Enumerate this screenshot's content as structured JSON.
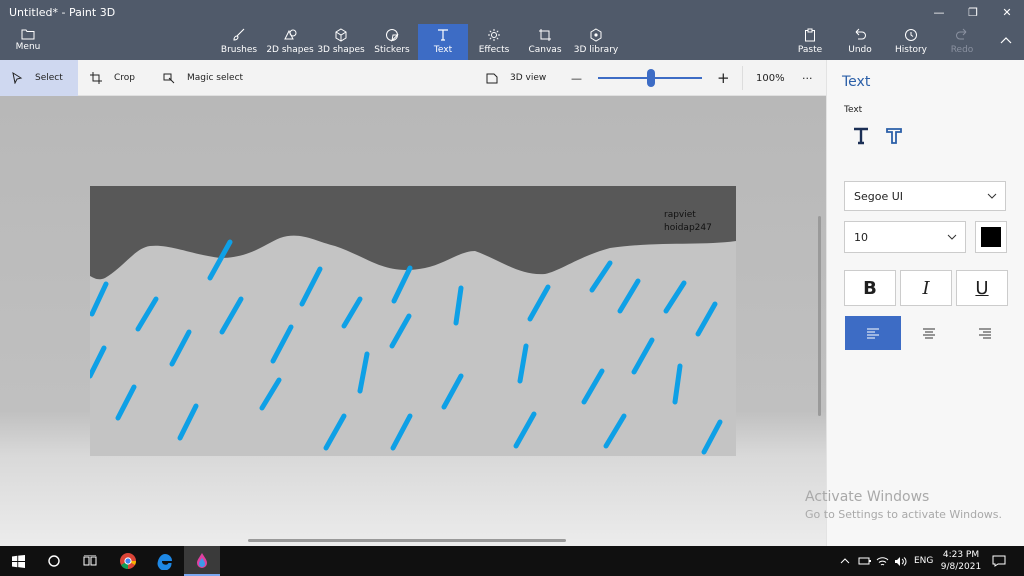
{
  "window": {
    "title": "Untitled* - Paint 3D"
  },
  "ribbon": {
    "menu_label": "Menu",
    "tools": [
      {
        "label": "Brushes"
      },
      {
        "label": "2D shapes"
      },
      {
        "label": "3D shapes"
      },
      {
        "label": "Stickers"
      },
      {
        "label": "Text"
      },
      {
        "label": "Effects"
      },
      {
        "label": "Canvas"
      },
      {
        "label": "3D library"
      }
    ],
    "right_tools": [
      {
        "label": "Paste"
      },
      {
        "label": "Undo"
      },
      {
        "label": "History"
      },
      {
        "label": "Redo"
      }
    ]
  },
  "subbar": {
    "select_label": "Select",
    "crop_label": "Crop",
    "magic_select_label": "Magic select",
    "view_3d_label": "3D view",
    "zoom_value": "100%",
    "zoom_minus": "—",
    "zoom_plus": "+",
    "more": "···"
  },
  "canvas": {
    "text_line1": "rapviet",
    "text_line2": "hoidap247",
    "sky_color": "#585858",
    "ground_color": "#c4c4c4",
    "rain_color": "#0ea0e6"
  },
  "panel": {
    "title": "Text",
    "subtitle": "Text",
    "font_family": "Segoe UI",
    "font_size": "10",
    "text_color": "#000000",
    "bold_label": "B",
    "italic_label": "I",
    "underline_label": "U"
  },
  "activation": {
    "line1": "Activate Windows",
    "line2": "Go to Settings to activate Windows."
  },
  "taskbar": {
    "language": "ENG",
    "time": "4:23 PM",
    "date": "9/8/2021"
  },
  "colors": {
    "accent": "#3d6cc5",
    "ribbon": "#505a6a"
  }
}
